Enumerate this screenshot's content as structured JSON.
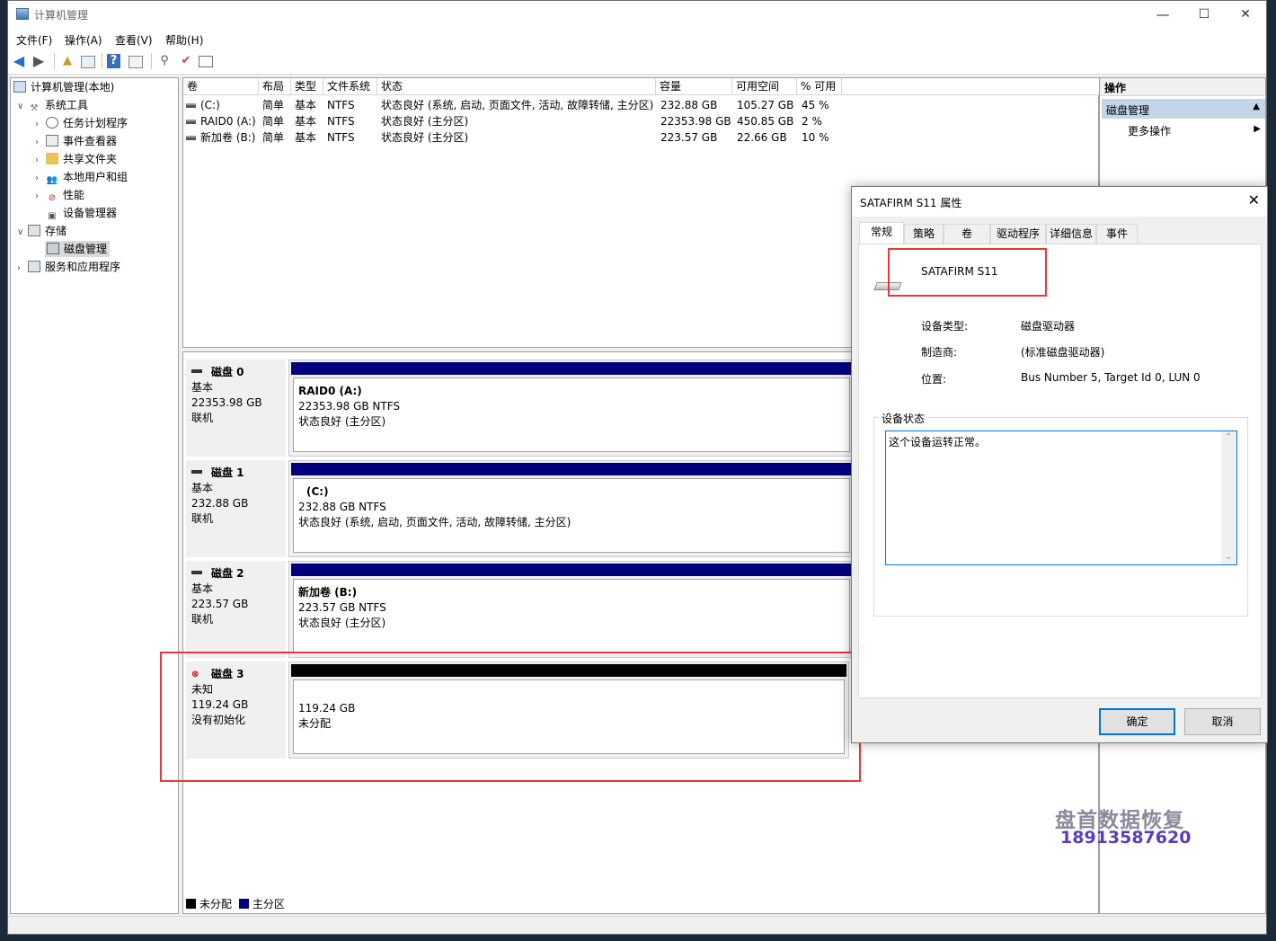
{
  "window": {
    "title": "计算机管理",
    "min": "—",
    "max": "☐",
    "close": "✕"
  },
  "menubar": [
    "文件(F)",
    "操作(A)",
    "查看(V)",
    "帮助(H)"
  ],
  "tree": {
    "root": "计算机管理(本地)",
    "system_tools": "系统工具",
    "task_scheduler": "任务计划程序",
    "event_viewer": "事件查看器",
    "shared_folders": "共享文件夹",
    "local_users": "本地用户和组",
    "performance": "性能",
    "device_manager": "设备管理器",
    "storage": "存储",
    "disk_management": "磁盘管理",
    "services_apps": "服务和应用程序"
  },
  "volume_table": {
    "headers": [
      "卷",
      "布局",
      "类型",
      "文件系统",
      "状态",
      "容量",
      "可用空间",
      "% 可用"
    ],
    "rows": [
      [
        "(C:)",
        "简单",
        "基本",
        "NTFS",
        "状态良好 (系统, 启动, 页面文件, 活动, 故障转储, 主分区)",
        "232.88 GB",
        "105.27 GB",
        "45 %"
      ],
      [
        "RAID0 (A:)",
        "简单",
        "基本",
        "NTFS",
        "状态良好 (主分区)",
        "22353.98 GB",
        "450.85 GB",
        "2 %"
      ],
      [
        "新加卷 (B:)",
        "简单",
        "基本",
        "NTFS",
        "状态良好 (主分区)",
        "223.57 GB",
        "22.66 GB",
        "10 %"
      ]
    ]
  },
  "disks": [
    {
      "name": "磁盘 0",
      "type": "基本",
      "size": "22353.98 GB",
      "state": "联机",
      "part_title": "RAID0  (A:)",
      "part_size": "22353.98 GB NTFS",
      "part_status": "状态良好 (主分区)"
    },
    {
      "name": "磁盘 1",
      "type": "基本",
      "size": "232.88 GB",
      "state": "联机",
      "part_title": "(C:)",
      "part_size": "232.88 GB NTFS",
      "part_status": "状态良好 (系统, 启动, 页面文件, 活动, 故障转储, 主分区)"
    },
    {
      "name": "磁盘 2",
      "type": "基本",
      "size": "223.57 GB",
      "state": "联机",
      "part_title": "新加卷  (B:)",
      "part_size": "223.57 GB NTFS",
      "part_status": "状态良好 (主分区)"
    },
    {
      "name": "磁盘 3",
      "type": "未知",
      "size": "119.24 GB",
      "state": "没有初始化",
      "part_size": "119.24 GB",
      "part_status": "未分配"
    }
  ],
  "legend": {
    "unallocated": "未分配",
    "primary": "主分区"
  },
  "actions": {
    "header": "操作",
    "section": "磁盘管理",
    "more": "更多操作"
  },
  "dialog": {
    "title": "SATAFIRM   S11 属性",
    "tabs": [
      "常规",
      "策略",
      "卷",
      "驱动程序",
      "详细信息",
      "事件"
    ],
    "device_name": "SATAFIRM   S11",
    "device_type_label": "设备类型:",
    "device_type": "磁盘驱动器",
    "manufacturer_label": "制造商:",
    "manufacturer": "(标准磁盘驱动器)",
    "location_label": "位置:",
    "location": "Bus Number 5, Target Id 0, LUN 0",
    "status_group": "设备状态",
    "status_text": "这个设备运转正常。",
    "ok": "确定",
    "cancel": "取消"
  },
  "colors": {
    "primary_partition": "#00007f",
    "unallocated": "#000000",
    "highlight_box": "#e8383d",
    "ok_border": "#0078d7"
  },
  "watermark": {
    "line1": "盘首数据恢复",
    "line2": "18913587620"
  }
}
